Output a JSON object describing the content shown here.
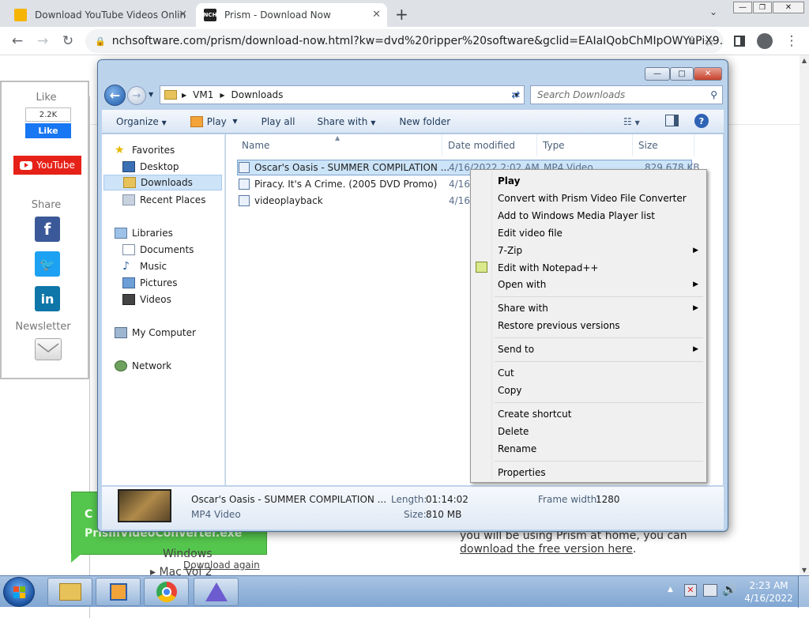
{
  "browser": {
    "tabs": [
      {
        "title": "Download YouTube Videos Onlin",
        "active": false
      },
      {
        "title": "Prism - Download Now",
        "active": true
      }
    ],
    "url": "nchsoftware.com/prism/download-now.html?kw=dvd%20ripper%20software&gclid=EAIaIQobChMIpOWYuPiX9..."
  },
  "webpage": {
    "like_label": "Like",
    "like_count": "2.2K",
    "fb_like_button": "Like",
    "youtube_button": "YouTube",
    "share_label": "Share",
    "newsletter_label": "Newsletter",
    "body_text": "you will be using Prism at home, you can",
    "download_free_link": "download the free version here",
    "period": ".",
    "download_again_link": "Download again",
    "banner_text": "PrismVideoConverter.exe",
    "banner_letter": "C",
    "list_partial_1": "Windows",
    "list_partial_2": "Mac Vol 2"
  },
  "explorer": {
    "breadcrumb": [
      "VM1",
      "Downloads"
    ],
    "search_placeholder": "Search Downloads",
    "commands": [
      "Organize",
      "Play",
      "Play all",
      "Share with",
      "New folder"
    ],
    "nav": {
      "favorites": "Favorites",
      "desktop": "Desktop",
      "downloads": "Downloads",
      "recent": "Recent Places",
      "libraries": "Libraries",
      "documents": "Documents",
      "music": "Music",
      "pictures": "Pictures",
      "videos": "Videos",
      "computer": "My Computer",
      "network": "Network"
    },
    "columns": [
      "Name",
      "Date modified",
      "Type",
      "Size"
    ],
    "files": [
      {
        "name": "Oscar's Oasis - SUMMER COMPILATION ...",
        "date": "4/16/2022 2:02 AM",
        "type": "MP4 Video",
        "size": "829,678 KB"
      },
      {
        "name": "Piracy. It's A Crime. (2005 DVD Promo)",
        "date": "4/16",
        "type": "",
        "size": ""
      },
      {
        "name": "videoplayback",
        "date": "4/16",
        "type": "",
        "size": ""
      }
    ],
    "details": {
      "title": "Oscar's Oasis - SUMMER COMPILATION ...",
      "type": "MP4 Video",
      "length_label": "Length:",
      "length": "01:14:02",
      "size_label": "Size:",
      "size": "810 MB",
      "frame_width_label": "Frame width:",
      "frame_width": "1280"
    }
  },
  "context_menu": {
    "play": "Play",
    "convert": "Convert with Prism Video File Converter",
    "add_wmp": "Add to Windows Media Player list",
    "edit_video": "Edit video file",
    "seven_zip": "7-Zip",
    "notepad": "Edit with Notepad++",
    "open_with": "Open with",
    "share_with": "Share with",
    "restore": "Restore previous versions",
    "send_to": "Send to",
    "cut": "Cut",
    "copy": "Copy",
    "shortcut": "Create shortcut",
    "delete": "Delete",
    "rename": "Rename",
    "properties": "Properties"
  },
  "taskbar": {
    "time": "2:23 AM",
    "date": "4/16/2022"
  },
  "colors": {
    "youtube_red": "#e62117",
    "facebook_blue": "#3b5998",
    "twitter_blue": "#1da1f2",
    "linkedin_blue": "#0e76a8",
    "banner_green": "#55c64d"
  }
}
